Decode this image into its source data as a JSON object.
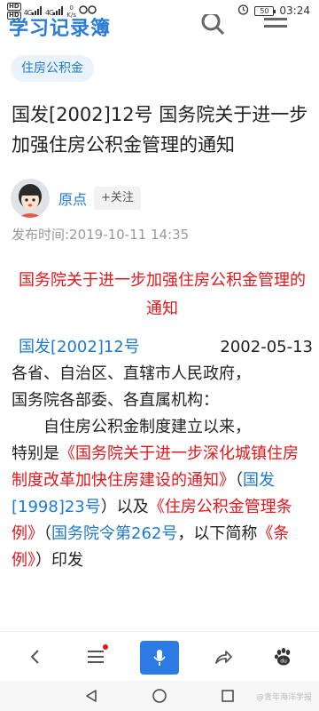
{
  "status_bar": {
    "hd1": "HD",
    "hd2": "HD",
    "signal1": "4G",
    "signal2": "4G",
    "speed": "0",
    "speed_unit": "K/s",
    "battery": "50",
    "time": "03:24"
  },
  "site": {
    "logo": "学习记录簿"
  },
  "tag": "住房公积金",
  "article": {
    "title": "国发[2002]12号 国务院关于进一步加强住房公积金管理的通知",
    "author": "原点",
    "follow": "+关注",
    "publish_time": "发布时间:2019-10-11 14:35"
  },
  "doc": {
    "title": "国务院关于进一步加强住房公积金管理的通知",
    "number": "国发[2002]12号",
    "date": "2002-05-13",
    "recipients_line1": "各省、自治区、直辖市人民政府，",
    "recipients_line2": "国务院各部委、各直属机构：",
    "p1_intro": "自住房公积金制度建立以来，",
    "p1_a": "特别是",
    "p1_link1": "《国务院关于进一步深化城镇住房制度改革加快住房建设的通知》",
    "p1_b": "（",
    "p1_link2": "国发[1998]23号",
    "p1_c": "）以及",
    "p1_link3": "《住房公积金管理条例》",
    "p1_d": "（",
    "p1_link4": "国务院令第262号",
    "p1_e": "，以下简称",
    "p1_link5": "《条例》",
    "p1_f": "）印发"
  },
  "toolbar": {
    "back": "back-icon",
    "menu": "menu-icon",
    "voice": "microphone-icon",
    "share": "share-icon",
    "home": "baidu-paw-icon"
  },
  "nav": {
    "watermark": "@青年海洋学报"
  },
  "colors": {
    "accent": "#1e7ad1",
    "red": "#e8161a",
    "voice": "#2c7be5"
  }
}
